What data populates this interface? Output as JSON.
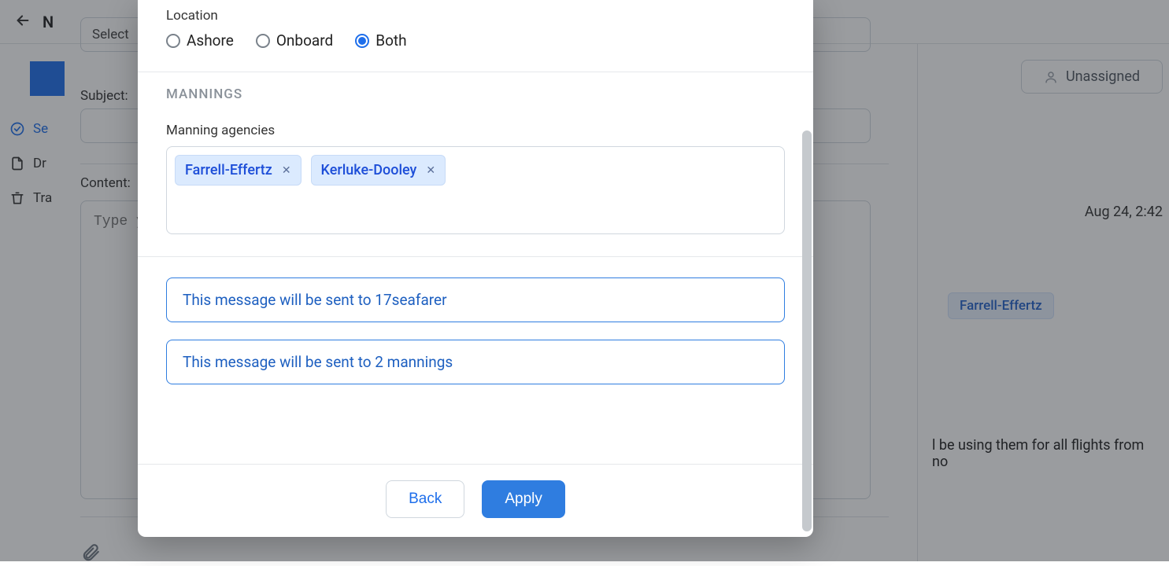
{
  "bg": {
    "title_first": "N",
    "select_placeholder": "Select",
    "subject_label": "Subject:",
    "content_label": "Content:",
    "content_placeholder": "Type y",
    "sidebar": {
      "sent": "Se",
      "drafts": "Dr",
      "trash": "Tra"
    },
    "right": {
      "unassigned": "Unassigned",
      "date": "Aug 24, 2:42",
      "tag": "Farrell-Effertz",
      "bodytext": "l be using them for all flights from no"
    }
  },
  "modal": {
    "location": {
      "label": "Location",
      "options": {
        "ashore": "Ashore",
        "onboard": "Onboard",
        "both": "Both"
      },
      "selected": "both"
    },
    "mannings": {
      "heading": "MANNINGS",
      "agencies_label": "Manning agencies",
      "chips": [
        "Farrell-Effertz",
        "Kerluke-Dooley"
      ]
    },
    "info": {
      "seafarers_prefix": "This message will be sent to ",
      "seafarers_count": "17",
      "seafarers_suffix": "seafarer",
      "mannings_text": "This message will be sent to 2 mannings"
    },
    "footer": {
      "back": "Back",
      "apply": "Apply"
    }
  }
}
